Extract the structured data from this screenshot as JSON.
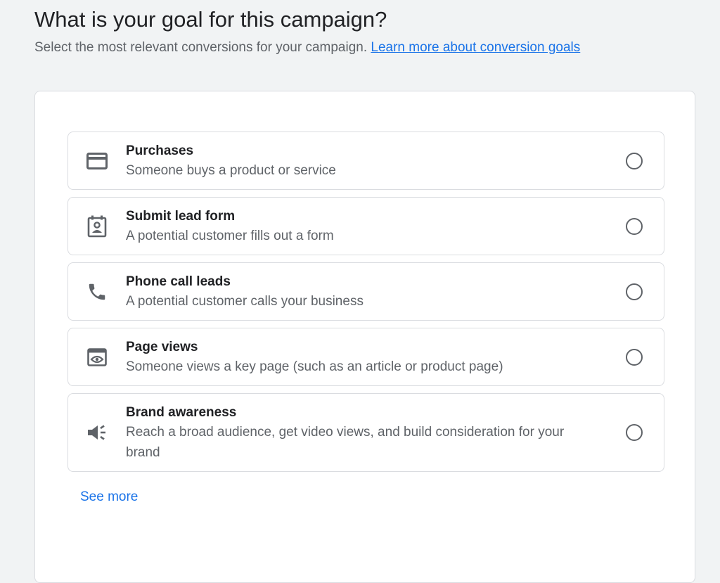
{
  "header": {
    "title": "What is your goal for this campaign?",
    "subtitle": "Select the most relevant conversions for your campaign.",
    "link": "Learn more about conversion goals"
  },
  "options": [
    {
      "title": "Purchases",
      "description": "Someone buys a product or service",
      "icon": "credit-card-icon"
    },
    {
      "title": "Submit lead form",
      "description": "A potential customer fills out a form",
      "icon": "contact-form-icon"
    },
    {
      "title": "Phone call leads",
      "description": "A potential customer calls your business",
      "icon": "phone-icon"
    },
    {
      "title": "Page views",
      "description": "Someone views a key page (such as an article or product page)",
      "icon": "page-view-icon"
    },
    {
      "title": "Brand awareness",
      "description": "Reach a broad audience, get video views, and build consideration for your brand",
      "icon": "megaphone-icon"
    }
  ],
  "see_more": "See more",
  "colors": {
    "accent": "#1a73e8",
    "text_primary": "#202124",
    "text_secondary": "#5f6368",
    "border": "#dadce0",
    "background": "#f1f3f4"
  }
}
